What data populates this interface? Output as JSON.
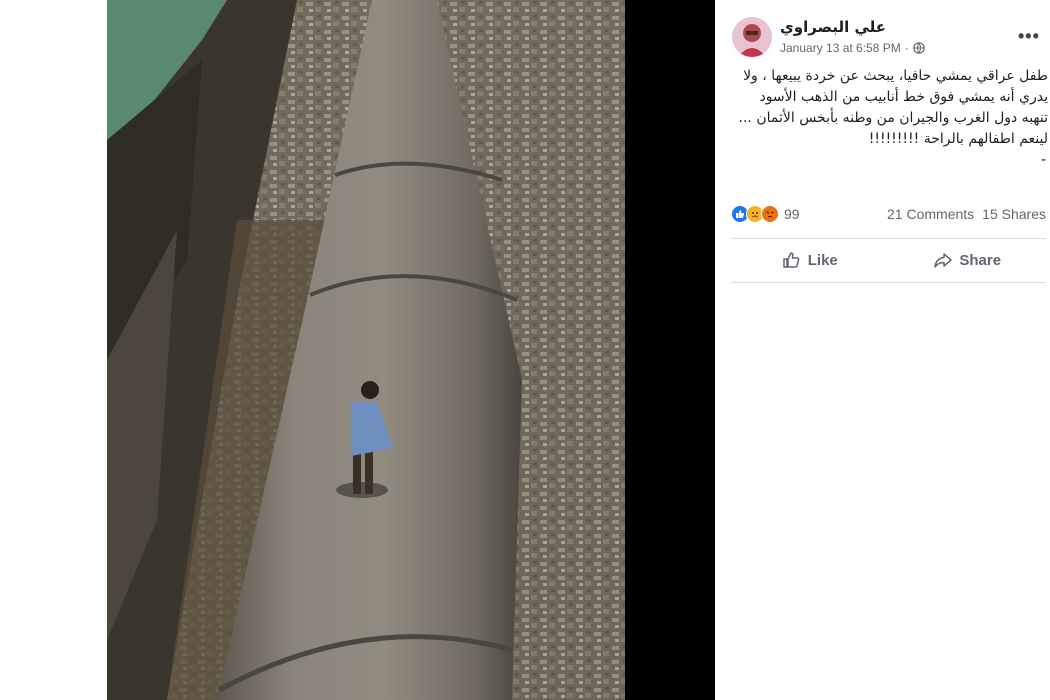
{
  "post": {
    "author": "علي البصراوي",
    "timestamp": "January 13 at 6:58 PM",
    "separator": "·",
    "privacy_icon": "globe-icon",
    "more_label": "•••",
    "text": "طفل عراقي يمشي حافيا، يبحث عن خردة يبيعها ، ولا يدري أنه يمشي فوق خط أنابيب من الذهب الأسود تنهبه دول الغرب والجيران من وطنه بأبخس الأثمان ... لينعم اطفالهم بالراحة !!!!!!!!!",
    "text_tail": "-"
  },
  "stats": {
    "reaction_icons": [
      "like-icon",
      "sad-icon",
      "angry-icon"
    ],
    "reactions_count": "99",
    "comments": "21 Comments",
    "shares": "15 Shares"
  },
  "actions": {
    "like_label": "Like",
    "share_label": "Share"
  },
  "colors": {
    "accent": "#1877f2",
    "text": "#1c1e21",
    "muted": "#606770",
    "viewer_bg": "#000000"
  }
}
